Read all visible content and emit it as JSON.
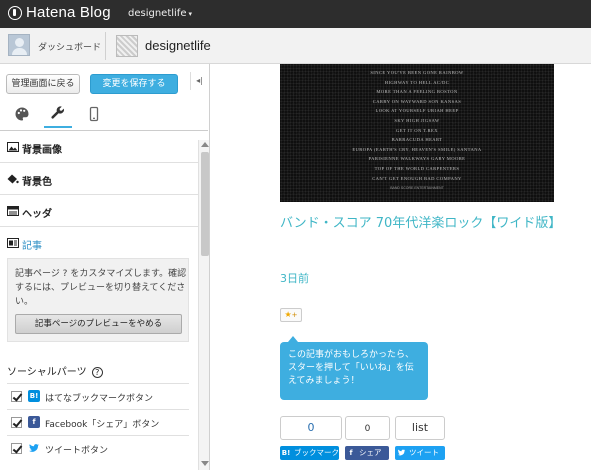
{
  "topbar": {
    "brand": "Hatena Blog",
    "blog_selector": "designetlife"
  },
  "header": {
    "dashboard": "ダッシュボード",
    "blog_name": "designetlife"
  },
  "sidebar": {
    "back_button": "管理画面に戻る",
    "save_button": "変更を保存する",
    "collapse": "◂|",
    "tabs": [
      "design-palette",
      "customize-wrench",
      "smartphone"
    ],
    "sections": [
      {
        "label": "背景画像",
        "icon": "image-icon"
      },
      {
        "label": "背景色",
        "icon": "fill-icon"
      },
      {
        "label": "ヘッダ",
        "icon": "header-icon"
      },
      {
        "label": "記事",
        "icon": "article-icon",
        "active": true
      }
    ],
    "help_text": "記事ページ ? をカスタマイズします。確認するには、プレビューを切り替えてください。",
    "preview_button": "記事ページのプレビューをやめる",
    "social_title": "ソーシャルパーツ",
    "social_help": "?",
    "social_items": [
      {
        "label": "はてなブックマークボタン",
        "icon": "B!",
        "color": "#008fde",
        "checked": true
      },
      {
        "label": "Facebook「シェア」ボタン",
        "icon": "f",
        "color": "#3b5998",
        "checked": true
      },
      {
        "label": "ツイートボタン",
        "icon": "t",
        "color": "#1da1f2",
        "checked": true
      }
    ]
  },
  "preview": {
    "hero_lines": [
      "SINCE YOU'VE BEEN GONE RAINBOW",
      "HIGHWAY TO HELL AC/DC",
      "MORE THAN A FEELING BOSTON",
      "CARRY ON WAYWARD SON KANSAS",
      "LOOK AT YOURSELF URIAH HEEP",
      "SKY HIGH JIGSAW",
      "GET IT ON T.REX",
      "BARRACUDA HEART",
      "EUROPA (EARTH'S CRY, HEAVEN'S SMILE) SANTANA",
      "PARISIENNE WALKWAYS GARY MOORE",
      "TOP OF THE WORLD CARPENTERS",
      "CAN'T GET ENOUGH BAD COMPANY"
    ],
    "hero_credit": "BAND SCORE ENTERTAINMENT",
    "post_title": "バンド・スコア 70年代洋楽ロック【ワイド版】",
    "post_date": "3日前",
    "star_button": "★+",
    "tooltip": "この記事がおもしろかったら、スターを押して「いいね」を伝えてみましょう！",
    "share_counts": {
      "hatena": "0",
      "facebook": "0",
      "list": "list"
    },
    "share_buttons": {
      "hatena": "ブックマーク",
      "facebook": "シェア",
      "twitter": "ツイート"
    },
    "colors": {
      "accent": "#3eaee0",
      "link": "#3fb6c6",
      "hatena": "#008fde",
      "facebook": "#3b5998",
      "twitter": "#1da1f2"
    }
  }
}
